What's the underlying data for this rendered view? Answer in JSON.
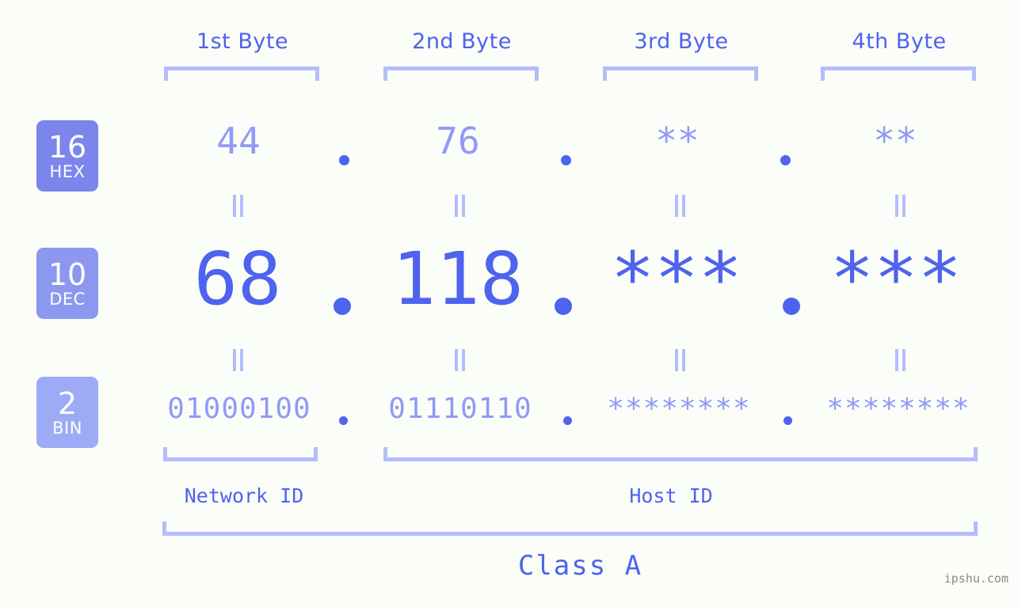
{
  "background": "#fbfdf8",
  "accent": "#4e63ee",
  "accent_light": "#8f9bf5",
  "accent_pale": "#b3bdfb",
  "headers": {
    "byte1": "1st Byte",
    "byte2": "2nd Byte",
    "byte3": "3rd Byte",
    "byte4": "4th Byte"
  },
  "bases": {
    "hex": {
      "num": "16",
      "name": "HEX",
      "color": "#7b85ec"
    },
    "dec": {
      "num": "10",
      "name": "DEC",
      "color": "#8c97f0"
    },
    "bin": {
      "num": "2",
      "name": "BIN",
      "color": "#9dabf6"
    }
  },
  "rows": {
    "hex": {
      "octets": [
        "44",
        "76",
        "**",
        "**"
      ],
      "separator": "."
    },
    "dec": {
      "octets": [
        "68",
        "118",
        "***",
        "***"
      ],
      "separator": "."
    },
    "bin": {
      "octets": [
        "01000100",
        "01110110",
        "********",
        "********"
      ],
      "separator": "."
    }
  },
  "connectors": {
    "symbol": "="
  },
  "sections": {
    "network_id": "Network ID",
    "host_id": "Host ID",
    "class": "Class A"
  },
  "watermark": "ipshu.com"
}
